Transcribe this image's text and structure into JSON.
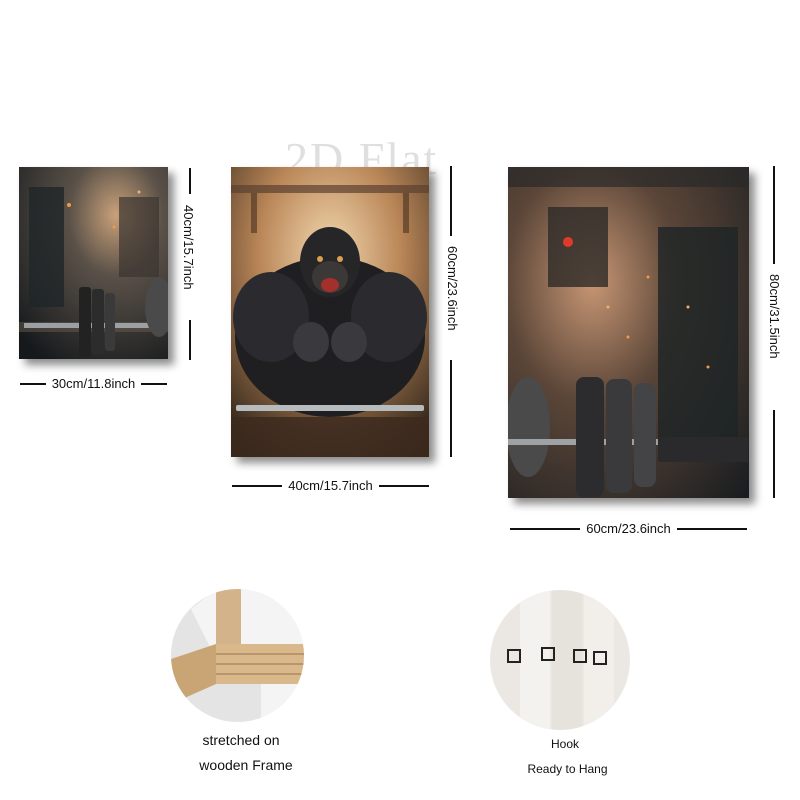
{
  "watermark": "2D Flat",
  "canvases": [
    {
      "width_label": "30cm/11.8inch",
      "height_label": "40cm/15.7inch"
    },
    {
      "width_label": "40cm/15.7inch",
      "height_label": "60cm/23.6inch"
    },
    {
      "width_label": "60cm/23.6inch",
      "height_label": "80cm/31.5inch"
    }
  ],
  "details": {
    "frame": {
      "line1": "stretched on",
      "line2": "wooden Frame",
      "icon": "wooden-frame-photo"
    },
    "hook": {
      "line1": "Hook",
      "line2": "Ready to Hang",
      "icon": "hook-photo"
    }
  },
  "colors": {
    "fire": "#d86a2a",
    "dark": "#1c1f22",
    "wood": "#d9b98c"
  }
}
